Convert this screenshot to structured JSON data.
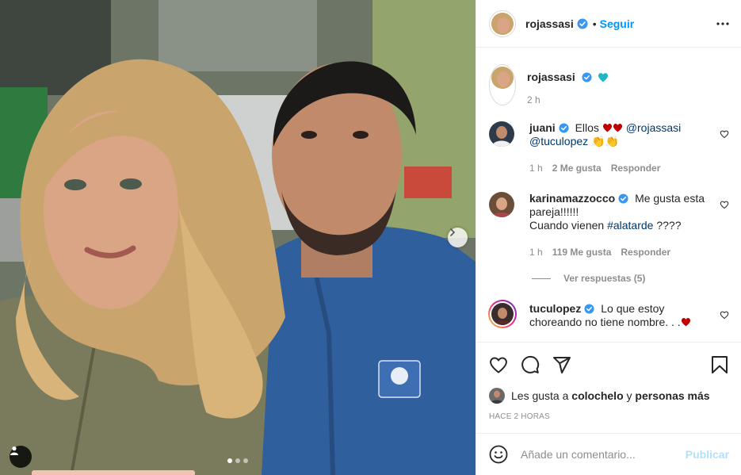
{
  "post": {
    "author": "rojassasi",
    "follow_label": "Seguir",
    "bullet": "•",
    "image_dots": 3,
    "active_dot": 0
  },
  "caption": {
    "author": "rojassasi",
    "time": "2 h"
  },
  "comments": [
    {
      "user": "juani",
      "text": "Ellos ",
      "mentions": "@rojassasi @tuculopez",
      "tail": " 👏👏",
      "time": "1 h",
      "likes": "2 Me gusta",
      "reply": "Responder"
    },
    {
      "user": "karinamazzocco",
      "text_line1": "Me gusta esta pareja!!!!!!",
      "text_line2": "Cuando vienen ",
      "hashtag": "#alatarde",
      "tail": " ????",
      "time": "1 h",
      "likes": "119 Me gusta",
      "reply": "Responder",
      "view_replies": "Ver respuestas (5)"
    },
    {
      "user": "tuculopez",
      "text": "Lo que estoy choreando no tiene nombre. . ."
    }
  ],
  "likes": {
    "prefix": "Les gusta a",
    "user": "colochelo",
    "and": "y",
    "others": "personas más"
  },
  "timestamp": "HACE 2 HORAS",
  "comment_box": {
    "placeholder": "Añade un comentario...",
    "publish": "Publicar"
  },
  "colors": {
    "link": "#0095f6",
    "verified": "#3897f0",
    "heart_red": "#c00000",
    "heart_teal": "#1fb6c6"
  },
  "icons": [
    "verified-icon",
    "more-icon",
    "heart-icon",
    "comment-icon",
    "share-icon",
    "save-icon",
    "emoji-icon",
    "chevron-right-icon",
    "user-tag-icon"
  ]
}
